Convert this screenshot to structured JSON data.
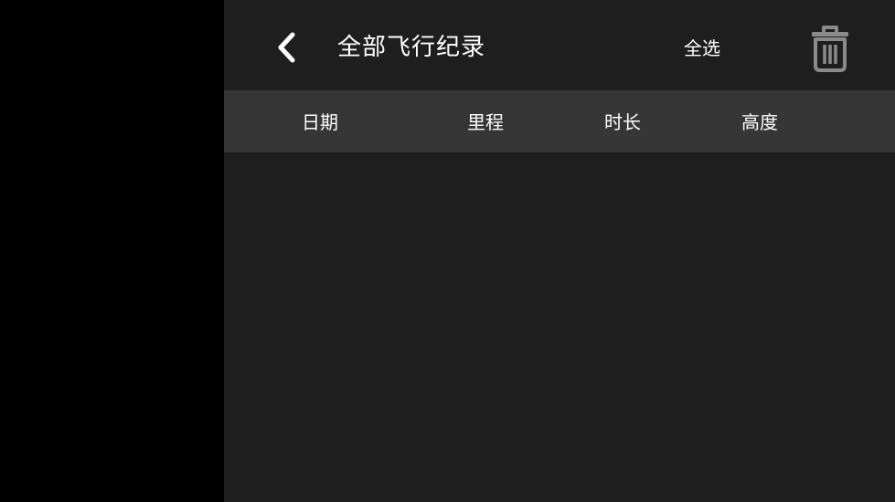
{
  "header": {
    "back_icon": "chevron-left-icon",
    "title": "全部飞行纪录",
    "select_all_label": "全选",
    "delete_icon": "trash-icon"
  },
  "table": {
    "columns": [
      "日期",
      "里程",
      "时长",
      "高度"
    ],
    "rows": []
  },
  "colors": {
    "background": "#1e1e1e",
    "left_pane": "#000000",
    "column_header_bg": "#363636",
    "text": "#ffffff",
    "icon_gray": "#8a8a8a"
  }
}
